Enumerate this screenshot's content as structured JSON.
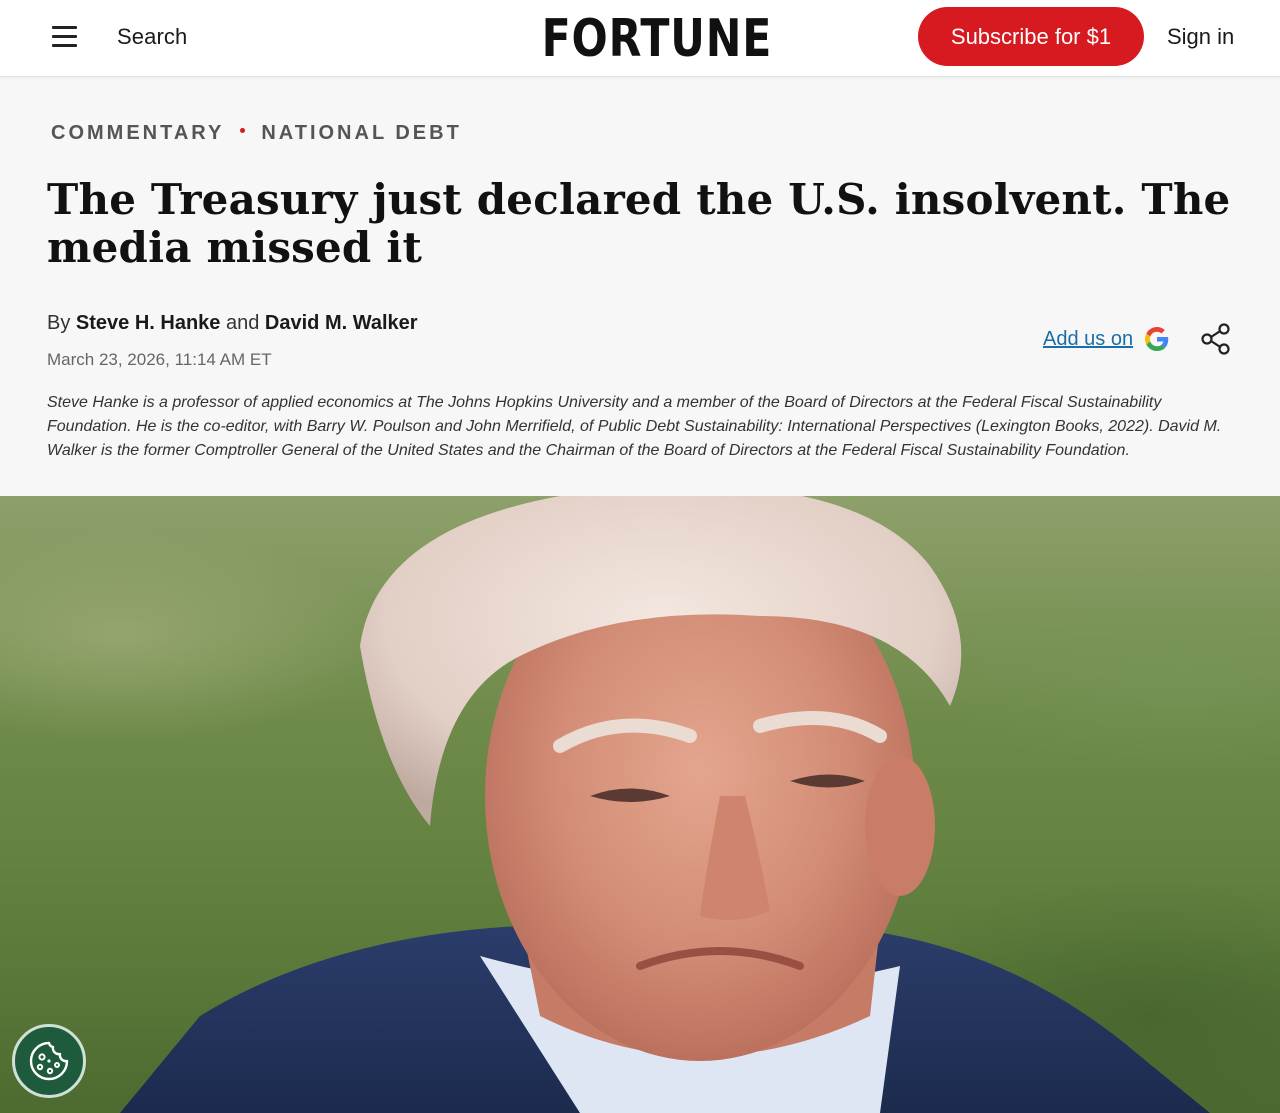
{
  "header": {
    "search_label": "Search",
    "logo": "FORTUNE",
    "subscribe_label": "Subscribe for $1",
    "signin_label": "Sign in"
  },
  "article": {
    "category": "COMMENTARY",
    "topic": "NATIONAL DEBT",
    "headline": "The Treasury just declared the U.S. insolvent. The media missed it",
    "byline_prefix": "By",
    "author1": "Steve H. Hanke",
    "byline_and": "and",
    "author2": "David M. Walker",
    "date": "March 23, 2026, 11:14 AM ET",
    "add_google_label": "Add us on",
    "bio": "Steve Hanke is a professor of applied economics at The Johns Hopkins University and a member of the Board of Directors at the Federal Fiscal Sustainability Foundation. He is the co-editor, with Barry W. Poulson and John Merrifield, of Public Debt Sustainability: International Perspectives (Lexington Books, 2022). David M. Walker is the former Comptroller General of the United States and the Chairman of the Board of Directors at the Federal Fiscal Sustainability Foundation."
  },
  "colors": {
    "accent_red": "#d71920",
    "link_blue": "#1a6ea8",
    "cookie_green": "#1e5a3c"
  },
  "icons": {
    "menu": "hamburger-menu-icon",
    "google": "google-g-icon",
    "share": "share-icon",
    "cookie": "cookie-icon"
  }
}
